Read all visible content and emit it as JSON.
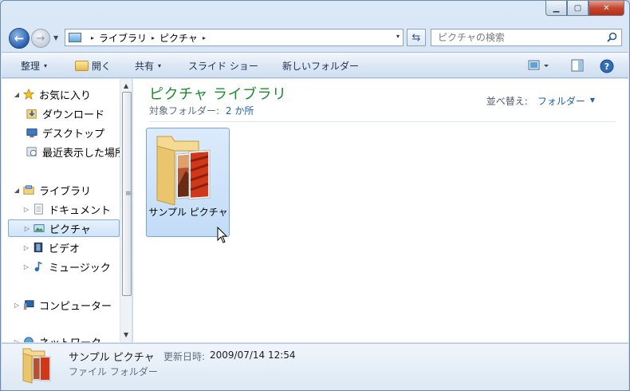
{
  "titlebar": {
    "minimize_glyph": "▁",
    "maximize_glyph": "▢",
    "close_glyph": "✕"
  },
  "address": {
    "crumbs": [
      "ライブラリ",
      "ピクチャ"
    ],
    "separator": "▸",
    "dropdown_glyph": "▾"
  },
  "search": {
    "placeholder": "ピクチャの検索"
  },
  "toolbar": {
    "organize": "整理",
    "open": "開く",
    "share": "共有",
    "slideshow": "スライド ショー",
    "new_folder": "新しいフォルダー",
    "dropdown_glyph": "▾"
  },
  "nav": {
    "favorites": "お気に入り",
    "downloads": "ダウンロード",
    "desktop": "デスクトップ",
    "recent": "最近表示した場所",
    "libraries": "ライブラリ",
    "documents": "ドキュメント",
    "pictures": "ピクチャ",
    "videos": "ビデオ",
    "music": "ミュージック",
    "computer": "コンピューター",
    "network": "ネットワーク",
    "expanded_glyph": "◢",
    "collapsed_glyph": "▷"
  },
  "content": {
    "title": "ピクチャ ライブラリ",
    "subtitle_label": "対象フォルダー:",
    "subtitle_link": "2 か所",
    "arrange_label": "並べ替え:",
    "arrange_value": "フォルダー",
    "folder_label": "サンプル ピクチャ"
  },
  "details": {
    "name": "サンプル ピクチャ",
    "date_label": "更新日時:",
    "date_value": "2009/07/14 12:54",
    "type": "ファイル フォルダー"
  }
}
